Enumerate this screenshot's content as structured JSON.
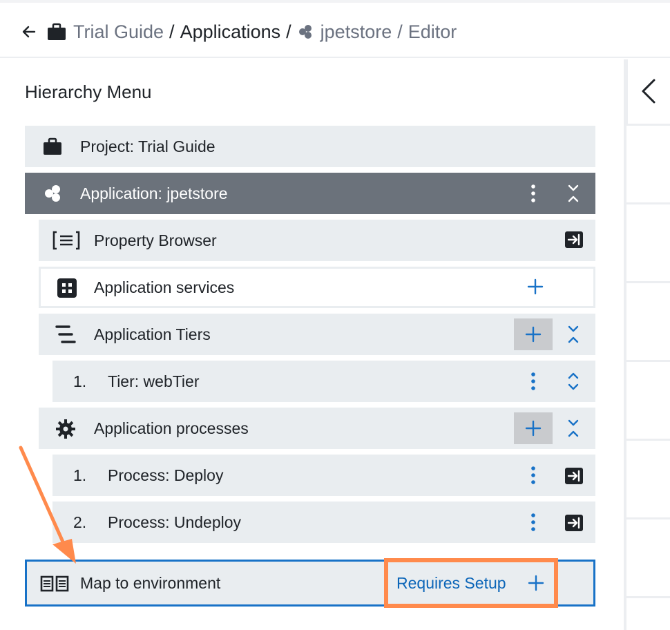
{
  "breadcrumb": {
    "project": "Trial Guide",
    "sep1": "/",
    "applications": "Applications",
    "sep2": "/",
    "app": "jpetstore",
    "sep3": "/",
    "page": "Editor"
  },
  "panel": {
    "title": "Hierarchy Menu"
  },
  "rows": {
    "project": "Project: Trial Guide",
    "application": "Application: jpetstore",
    "property_browser": "Property Browser",
    "app_services": "Application services",
    "app_tiers": "Application Tiers",
    "tier_num": "1.",
    "tier": "Tier: webTier",
    "app_processes": "Application processes",
    "proc1_num": "1.",
    "proc1": "Process: Deploy",
    "proc2_num": "2.",
    "proc2": "Process: Undeploy",
    "map_env": "Map to environment",
    "requires_setup": "Requires Setup"
  },
  "colors": {
    "selected_row": "#6b727b",
    "row_bg": "#e9edf0",
    "accent_blue": "#1872c7",
    "highlight_orange": "#ff8a4c"
  }
}
